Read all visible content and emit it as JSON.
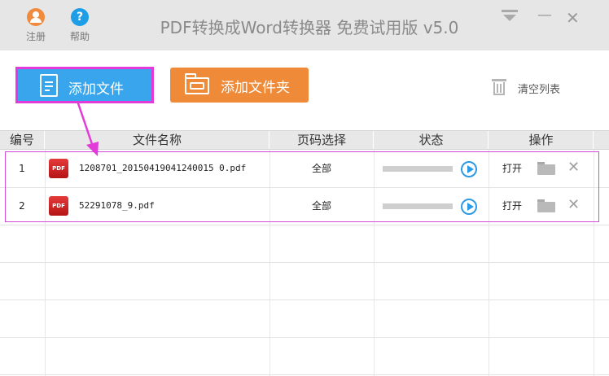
{
  "titlebar": {
    "register_label": "注册",
    "help_label": "帮助",
    "help_glyph": "?",
    "title": "PDF转换成Word转换器 免费试用版 v5.0",
    "minimize_glyph": "—",
    "close_glyph": "✕"
  },
  "toolbar": {
    "add_file_label": "添加文件",
    "add_folder_label": "添加文件夹",
    "clear_list_label": "清空列表"
  },
  "table": {
    "columns": [
      "编号",
      "文件名称",
      "页码选择",
      "状态",
      "操作"
    ],
    "rows": [
      {
        "num": "1",
        "name": "1208701_20150419041240015 0.pdf",
        "page": "全部",
        "open": "打开",
        "progress": 0
      },
      {
        "num": "2",
        "name": "52291078_9.pdf",
        "page": "全部",
        "open": "打开",
        "progress": 0
      }
    ]
  },
  "icons": {
    "pdf_badge": "PDF",
    "delete_glyph": "✕"
  },
  "colors": {
    "primary_blue": "#38a5ec",
    "orange": "#ee8a38",
    "annotation_magenta": "#e23bd9"
  }
}
